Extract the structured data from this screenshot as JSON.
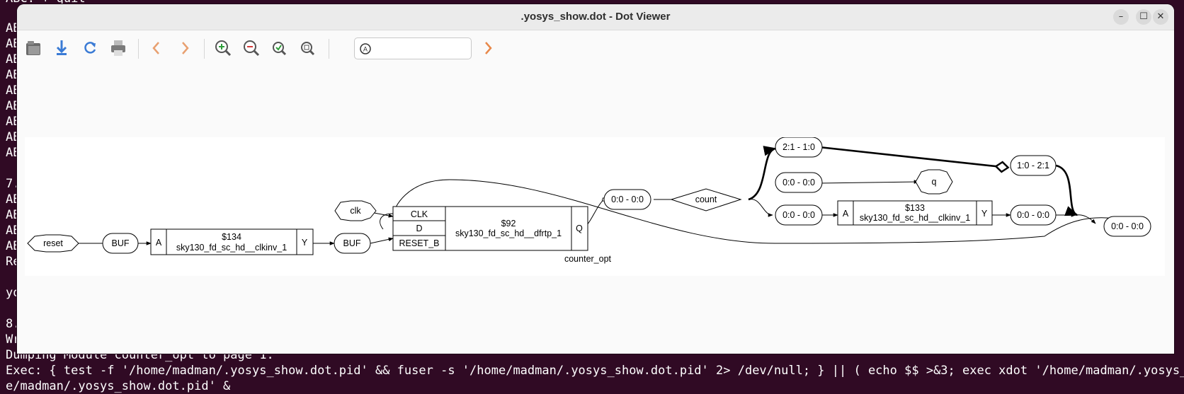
{
  "terminal": {
    "lines_top": [
      "ABC: + quit",
      "AB",
      "AB",
      "AB",
      "AB",
      "AB",
      "AB",
      "AB",
      "AB",
      "AB",
      "AB"
    ],
    "lines_mid": [
      "7.",
      "AB",
      "AB",
      "AB",
      "AB",
      "Re",
      "",
      "yo",
      "",
      "8.",
      "Wr"
    ],
    "dumping": "Dumping Module counter_opt to page 1.",
    "exec": "Exec: { test -f '/home/madman/.yosys_show.dot.pid' && fuser -s '/home/madman/.yosys_show.dot.pid' 2> /dev/null; } || ( echo $$ >&3; exec xdot '/home/madman/.yosys_show",
    "exec_cont": "e/madman/.yosys_show.dot.pid' &"
  },
  "window": {
    "title": ".yosys_show.dot - Dot Viewer",
    "minimize": "–",
    "maximize": "☐",
    "close": "✕"
  },
  "toolbar": {
    "icons": [
      "open-icon",
      "export-icon",
      "reload-icon",
      "print-icon",
      "back-icon",
      "forward-icon",
      "zoom-in-icon",
      "zoom-out-icon",
      "zoom-fit-icon",
      "zoom-100-icon",
      "find-next-icon"
    ],
    "search": {
      "value": "",
      "placeholder": ""
    }
  },
  "graph": {
    "module_label": "counter_opt",
    "reset": "reset",
    "clk": "clk",
    "buf1": "BUF",
    "buf2": "BUF",
    "cell134": {
      "id": "$134",
      "type": "sky130_fd_sc_hd__clkinv_1",
      "in": "A",
      "out": "Y"
    },
    "cell92": {
      "id": "$92",
      "type": "sky130_fd_sc_hd__dfrtp_1",
      "in_clk": "CLK",
      "in_d": "D",
      "in_reset": "RESET_B",
      "out": "Q"
    },
    "cell133": {
      "id": "$133",
      "type": "sky130_fd_sc_hd__clkinv_1",
      "in": "A",
      "out": "Y"
    },
    "count": "count",
    "q": "q",
    "slice_q_out": "0:0 - 0:0",
    "slice_top": "2:1 - 1:0",
    "slice_mid": "0:0 - 0:0",
    "slice_bot": "0:0 - 0:0",
    "slice_inv_out": "0:0 - 0:0",
    "slice_right": "1:0 - 2:1",
    "slice_merge": "0:0 - 0:0"
  },
  "colors": {
    "terminal_bg": "#300a24",
    "window_bg": "#fafafa",
    "canvas_bg": "#ffffff",
    "icon_blue": "#3a7bd5",
    "icon_orange": "#e8884a",
    "icon_green": "#2e9e3a",
    "icon_red": "#d43a3a"
  }
}
